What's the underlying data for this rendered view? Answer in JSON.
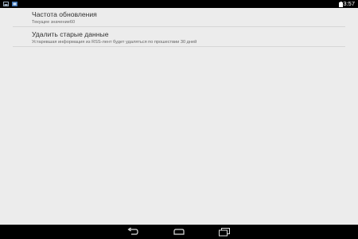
{
  "status_bar": {
    "time": "13:57",
    "icons": [
      "notification-icon",
      "notification-icon",
      "battery-icon"
    ]
  },
  "preferences": [
    {
      "title": "Частота обновления",
      "summary": "Текущее значение60"
    },
    {
      "title": "Удалить старые данные",
      "summary": "Устаревшая информация из RSS-лент будет удаляться по прошествии 30 дней"
    }
  ],
  "nav_bar": {
    "buttons": [
      "back-icon",
      "home-icon",
      "recent-apps-icon"
    ]
  }
}
